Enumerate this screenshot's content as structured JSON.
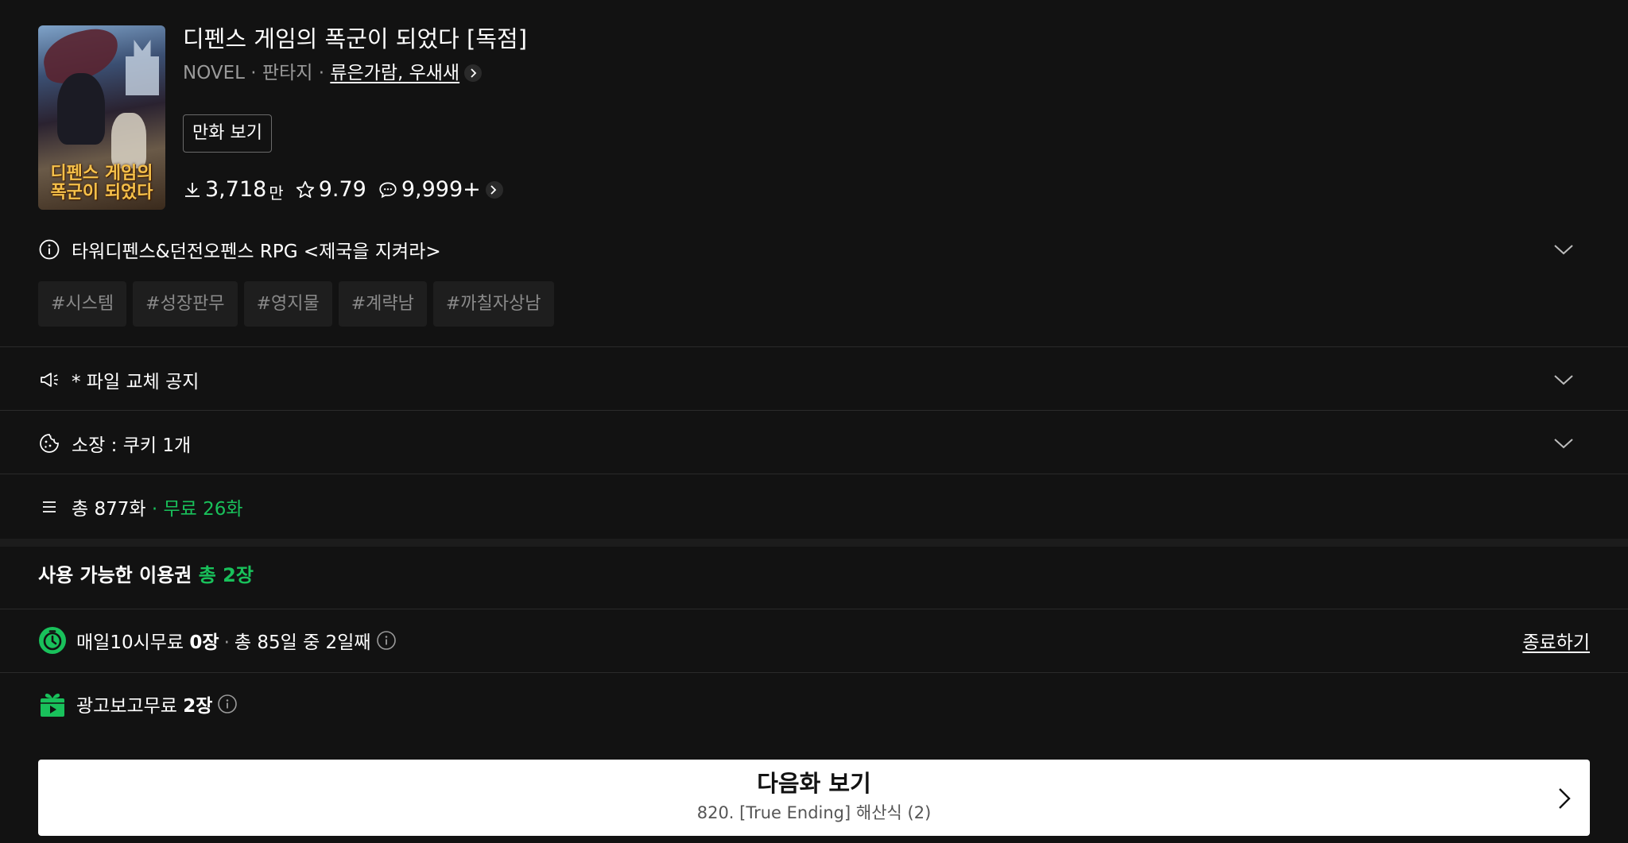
{
  "header": {
    "title": "디펜스 게임의 폭군이 되었다 [독점]",
    "type": "NOVEL",
    "genre": "판타지",
    "authors": "류은가람, 우새새",
    "comic_button_label": "만화 보기",
    "cover_title_line1": "디펜스 게임의",
    "cover_title_line2": "폭군이 되었다"
  },
  "meta_separator": " · ",
  "stats": {
    "views": "3,718",
    "views_unit": "만",
    "rating": "9.79",
    "comments": "9,999+"
  },
  "synopsis": "타워디펜스&던전오펜스 RPG <제국을 지켜라>",
  "tags": [
    "#시스템",
    "#성장판무",
    "#영지물",
    "#계략남",
    "#까칠자상남"
  ],
  "notice": "* 파일 교체 공지",
  "owned": "소장 : 쿠키 1개",
  "episodes": {
    "total": "총 877화",
    "separator": " · ",
    "free": "무료 26화"
  },
  "tickets": {
    "title": "사용 가능한 이용권",
    "total": "총 2장",
    "daily": {
      "label": "매일10시무료",
      "count": "0장",
      "separator": "·",
      "progress": "총 85일 중 2일째",
      "end_label": "종료하기"
    },
    "ad": {
      "label": "광고보고무료",
      "count": "2장"
    }
  },
  "next": {
    "label": "다음화 보기",
    "episode": "820. [True Ending] 해산식 (2)"
  },
  "colors": {
    "background": "#121212",
    "accent_green": "#19c15b",
    "tag_bg": "#1e1e1e",
    "cover_title": "#f5c04a"
  }
}
